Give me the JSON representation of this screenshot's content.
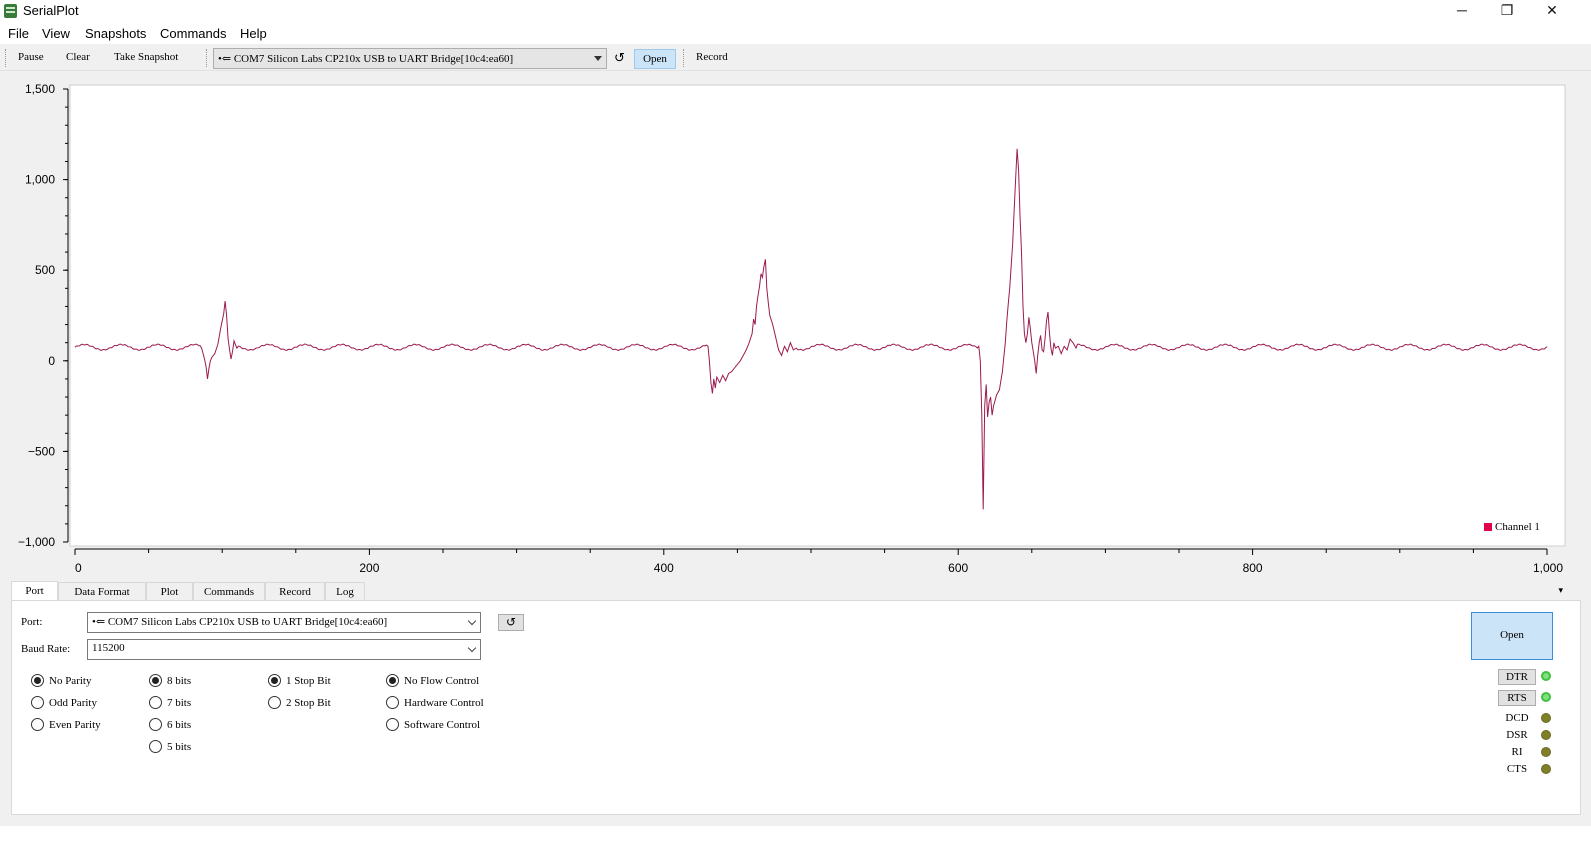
{
  "window": {
    "title": "SerialPlot",
    "minimize": "─",
    "restore": "❐",
    "close": "✕"
  },
  "menu": [
    "File",
    "View",
    "Snapshots",
    "Commands",
    "Help"
  ],
  "toolbar": {
    "pause": "Pause",
    "clear": "Clear",
    "snapshot": "Take Snapshot",
    "port": "•⇐ COM7 Silicon Labs CP210x USB to UART Bridge[10c4:ea60]",
    "refresh": "↺",
    "open": "Open",
    "record": "Record"
  },
  "chart_data": {
    "type": "line",
    "xlim": [
      0,
      1000
    ],
    "ylim": [
      -1000,
      1500
    ],
    "x_ticks": [
      "0",
      "200",
      "400",
      "600",
      "800",
      "1,000"
    ],
    "y_ticks": [
      "1,500",
      "1,000",
      "500",
      "0",
      "−500",
      "−1,000"
    ],
    "x_tick_values": [
      0,
      200,
      400,
      600,
      800,
      1000
    ],
    "y_tick_values": [
      1500,
      1000,
      500,
      0,
      -500,
      -1000
    ],
    "grid": false,
    "legend_position": "bottom-right",
    "series": [
      {
        "name": "Channel 1",
        "color": "#9c1a4f",
        "baseline": {
          "mean": 75,
          "amplitude": 15,
          "period": 25
        },
        "keypoints": [
          [
            86,
            70
          ],
          [
            87,
            40
          ],
          [
            88,
            10
          ],
          [
            89,
            -30
          ],
          [
            90,
            -100
          ],
          [
            91,
            -40
          ],
          [
            92,
            0
          ],
          [
            93,
            20
          ],
          [
            95,
            40
          ],
          [
            97,
            90
          ],
          [
            99,
            180
          ],
          [
            101,
            260
          ],
          [
            102,
            330
          ],
          [
            103,
            250
          ],
          [
            104,
            120
          ],
          [
            105,
            60
          ],
          [
            106,
            10
          ],
          [
            107,
            50
          ],
          [
            108,
            110
          ],
          [
            109,
            90
          ],
          [
            110,
            70
          ],
          [
            430,
            80
          ],
          [
            431,
            0
          ],
          [
            432,
            -120
          ],
          [
            433,
            -180
          ],
          [
            434,
            -100
          ],
          [
            435,
            -150
          ],
          [
            436,
            -90
          ],
          [
            438,
            -120
          ],
          [
            440,
            -80
          ],
          [
            442,
            -110
          ],
          [
            444,
            -70
          ],
          [
            446,
            -60
          ],
          [
            448,
            -40
          ],
          [
            450,
            -20
          ],
          [
            452,
            0
          ],
          [
            454,
            30
          ],
          [
            456,
            60
          ],
          [
            458,
            100
          ],
          [
            460,
            150
          ],
          [
            461,
            230
          ],
          [
            462,
            200
          ],
          [
            463,
            300
          ],
          [
            464,
            360
          ],
          [
            465,
            410
          ],
          [
            466,
            480
          ],
          [
            467,
            460
          ],
          [
            468,
            520
          ],
          [
            469,
            560
          ],
          [
            470,
            400
          ],
          [
            471,
            320
          ],
          [
            472,
            250
          ],
          [
            474,
            200
          ],
          [
            476,
            130
          ],
          [
            478,
            60
          ],
          [
            480,
            30
          ],
          [
            482,
            80
          ],
          [
            484,
            50
          ],
          [
            486,
            100
          ],
          [
            488,
            60
          ],
          [
            490,
            70
          ],
          [
            614,
            80
          ],
          [
            615,
            0
          ],
          [
            616,
            -300
          ],
          [
            617,
            -820
          ],
          [
            618,
            -250
          ],
          [
            619,
            -130
          ],
          [
            620,
            -310
          ],
          [
            621,
            -230
          ],
          [
            622,
            -200
          ],
          [
            623,
            -300
          ],
          [
            624,
            -250
          ],
          [
            626,
            -190
          ],
          [
            628,
            -160
          ],
          [
            630,
            -60
          ],
          [
            632,
            100
          ],
          [
            633,
            220
          ],
          [
            635,
            400
          ],
          [
            637,
            650
          ],
          [
            639,
            1000
          ],
          [
            640,
            1170
          ],
          [
            641,
            1050
          ],
          [
            642,
            800
          ],
          [
            643,
            600
          ],
          [
            644,
            300
          ],
          [
            645,
            150
          ],
          [
            646,
            100
          ],
          [
            647,
            150
          ],
          [
            648,
            240
          ],
          [
            649,
            180
          ],
          [
            650,
            100
          ],
          [
            651,
            50
          ],
          [
            652,
            0
          ],
          [
            653,
            -70
          ],
          [
            654,
            30
          ],
          [
            655,
            100
          ],
          [
            656,
            140
          ],
          [
            657,
            60
          ],
          [
            658,
            50
          ],
          [
            659,
            120
          ],
          [
            660,
            220
          ],
          [
            661,
            270
          ],
          [
            662,
            150
          ],
          [
            663,
            70
          ],
          [
            664,
            30
          ],
          [
            665,
            100
          ],
          [
            666,
            70
          ],
          [
            668,
            80
          ],
          [
            670,
            40
          ],
          [
            672,
            80
          ],
          [
            674,
            60
          ],
          [
            676,
            120
          ],
          [
            678,
            100
          ],
          [
            680,
            70
          ]
        ]
      }
    ]
  },
  "tabs": [
    "Port",
    "Data Format",
    "Plot",
    "Commands",
    "Record",
    "Log"
  ],
  "tab_scroll": "▾",
  "port_panel": {
    "port_label": "Port:",
    "port_value": "•⇐ COM7 Silicon Labs CP210x USB to UART Bridge[10c4:ea60]",
    "refresh": "↺",
    "baud_label": "Baud Rate:",
    "baud_value": "115200",
    "parity": [
      {
        "label": "No Parity",
        "checked": true
      },
      {
        "label": "Odd Parity",
        "checked": false
      },
      {
        "label": "Even Parity",
        "checked": false
      }
    ],
    "data_bits": [
      {
        "label": "8 bits",
        "checked": true
      },
      {
        "label": "7 bits",
        "checked": false
      },
      {
        "label": "6 bits",
        "checked": false
      },
      {
        "label": "5 bits",
        "checked": false
      }
    ],
    "stop_bits": [
      {
        "label": "1 Stop Bit",
        "checked": true
      },
      {
        "label": "2 Stop Bit",
        "checked": false
      }
    ],
    "flow": [
      {
        "label": "No Flow Control",
        "checked": true
      },
      {
        "label": "Hardware Control",
        "checked": false
      },
      {
        "label": "Software Control",
        "checked": false
      }
    ],
    "open_button": "Open",
    "dtr": "DTR",
    "rts": "RTS",
    "dcd": "DCD",
    "dsr": "DSR",
    "ri": "RI",
    "cts": "CTS",
    "led_colors": {
      "on": "#3fc03f",
      "off": "#7f7f2a"
    }
  }
}
